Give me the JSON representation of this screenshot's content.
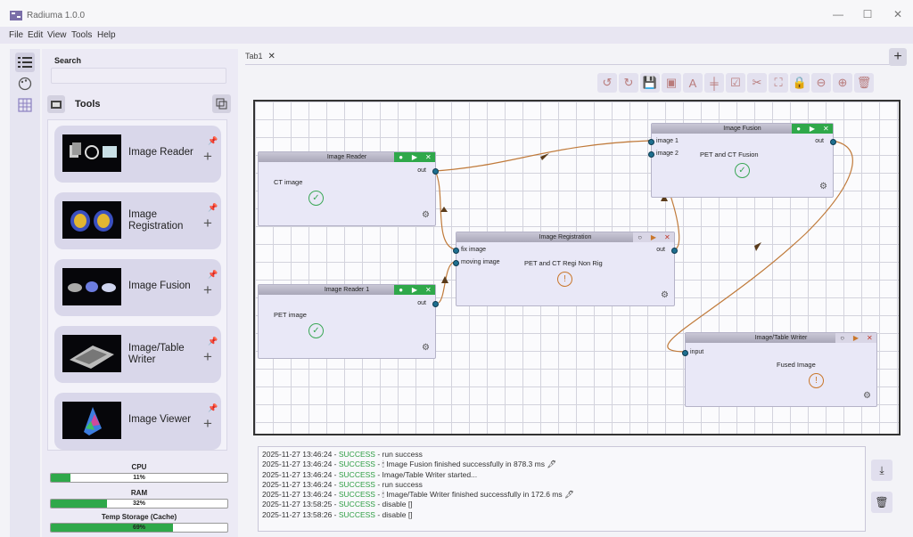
{
  "window": {
    "title": "Radiuma 1.0.0",
    "minimize": "—",
    "maximize": "☐",
    "close": "✕"
  },
  "menu": [
    "File",
    "Edit",
    "View",
    "Tools",
    "Help"
  ],
  "left": {
    "search_label": "Search",
    "search_placeholder": "",
    "tools_label": "Tools",
    "tools": [
      {
        "name": "Image Reader"
      },
      {
        "name": "Image\nRegistration"
      },
      {
        "name": "Image Fusion"
      },
      {
        "name": "Image/Table\nWriter"
      },
      {
        "name": "Image Viewer"
      }
    ],
    "cpu": {
      "label": "CPU",
      "value": "11%",
      "fraction": 0.11
    },
    "ram": {
      "label": "RAM",
      "value": "32%",
      "fraction": 0.32
    },
    "storage": {
      "label": "Temp Storage (Cache)",
      "value": "69%",
      "fraction": 0.69
    }
  },
  "tabs": [
    {
      "label": "Tab1",
      "close": "✕"
    }
  ],
  "add_tab": "+",
  "nodes": {
    "reader1": {
      "title": "Image Reader",
      "desc": "CT image",
      "out": "out"
    },
    "reader2": {
      "title": "Image Reader 1",
      "desc": "PET image",
      "out": "out"
    },
    "registration": {
      "title": "Image Registration",
      "desc": "PET and CT Regi Non Rig",
      "in1": "fix image",
      "in2": "moving image",
      "out": "out"
    },
    "fusion": {
      "title": "Image Fusion",
      "desc": "PET and CT Fusion",
      "in1": "image 1",
      "in2": "image 2",
      "out": "out"
    },
    "writer": {
      "title": "Image/Table Writer",
      "desc": "Fused Image",
      "in1": "input"
    }
  },
  "log": [
    {
      "time": "2025-11-27 13:46:24",
      "status": "SUCCESS",
      "msg": "run success"
    },
    {
      "time": "2025-11-27 13:46:24",
      "status": "SUCCESS",
      "msg": "🕯 Image Fusion finished successfully in 878.3 ms 🖋"
    },
    {
      "time": "2025-11-27 13:46:24",
      "status": "SUCCESS",
      "msg": "Image/Table Writer started..."
    },
    {
      "time": "2025-11-27 13:46:24",
      "status": "SUCCESS",
      "msg": "run success"
    },
    {
      "time": "2025-11-27 13:46:24",
      "status": "SUCCESS",
      "msg": "🕯 Image/Table Writer finished successfully in 172.6 ms 🖋"
    },
    {
      "time": "2025-11-27 13:58:25",
      "status": "SUCCESS",
      "msg": "disable []"
    },
    {
      "time": "2025-11-27 13:58:26",
      "status": "SUCCESS",
      "msg": "disable []"
    }
  ],
  "colors": {
    "accent": "#2fa84a",
    "link": "#c07a3a",
    "port": "#1f6f8f"
  }
}
